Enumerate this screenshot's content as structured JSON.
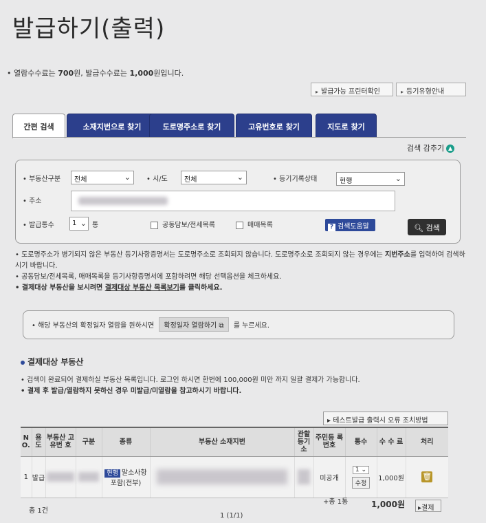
{
  "page": {
    "title": "발급하기(출력)"
  },
  "fee_note": {
    "prefix": "• 열람수수료는 ",
    "view_fee": "700",
    "mid": "원, 발급수수료는 ",
    "issue_fee": "1,000",
    "suffix": "원입니다."
  },
  "top_buttons": {
    "printer_check": "발급가능 프린터확인",
    "register_type_guide": "등기유형안내"
  },
  "tabs": [
    {
      "label": "간편 검색",
      "active": true
    },
    {
      "label": "소재지번으로 찾기",
      "active": false
    },
    {
      "label": "도로명주소로 찾기",
      "active": false
    },
    {
      "label": "고유번호로 찾기",
      "active": false
    },
    {
      "label": "지도로 찾기",
      "active": false
    }
  ],
  "collapse_search": "검색 감추기",
  "search": {
    "property_type": {
      "label": "• 부동산구분",
      "value": "전체"
    },
    "province": {
      "label": "• 시/도",
      "value": "전체"
    },
    "record_status": {
      "label": "• 등기기록상태",
      "value": "현행"
    },
    "address": {
      "label": "• 주소"
    },
    "issue_count": {
      "label": "• 발급통수",
      "value": "1",
      "unit": "통"
    },
    "joint_collateral": "공동담보/전세목록",
    "sale_list": "매매목록",
    "help_button": "검색도움말",
    "search_button": "검색"
  },
  "notes": {
    "line1a": "• 도로명주소가 병기되지 않은 부동산 등기사항증명서는 도로명주소로 조회되지 않습니다. 도로명주소로 조회되지 않는 경우에는 ",
    "line1b": "지번주소",
    "line1c": "를 입력하여 검색하시기 바랍니다.",
    "line2": "• 공동담보/전세목록, 매매목록을 등기사항증명서에 포함하려면 해당 선택옵션을 체크하세요.",
    "line3a": "• 결제대상 부동산을 보시려면 ",
    "line3b": "결제대상 부동산 목록보기",
    "line3c": "를 클릭하세요."
  },
  "info_box": {
    "prefix": "• 해당 부동산의 확정일자 열람을 원하시면",
    "button": "확정일자 열람하기",
    "suffix": "를 누르세요."
  },
  "section": {
    "title": "결제대상 부동산",
    "note1": "• 검색이 완료되어 결제하실 부동산 목록입니다. 로그인 하시면 한번에 100,000원 미만 까지 일괄 결제가 가능합니다.",
    "note2": "• 결제 후 발급/열람하지 못하신 경우 미발급/미열람을 참고하시기 바랍니다."
  },
  "error_button": "테스트발급 출력시 오류 조치방법",
  "table": {
    "headers": [
      "N O.",
      "용 도",
      "부동산 고유번 호",
      "구분",
      "종류",
      "부동산 소재지번",
      "관할 등기 소",
      "주민등 록번호",
      "통수",
      "수 수 료",
      "처리"
    ],
    "rows": [
      {
        "no": "1",
        "use": "발급",
        "kind_tag": "현행",
        "kind": "말소사항포함(전부)",
        "resident_no": "미공개",
        "count": "1",
        "count_button": "수정",
        "fee": "1,000원"
      }
    ]
  },
  "footer": {
    "total_items": "총 1건",
    "total_count": "+총 1통",
    "total_amount": "1,000원",
    "pay_button": "결제",
    "pagination": "1 (1/1)"
  }
}
